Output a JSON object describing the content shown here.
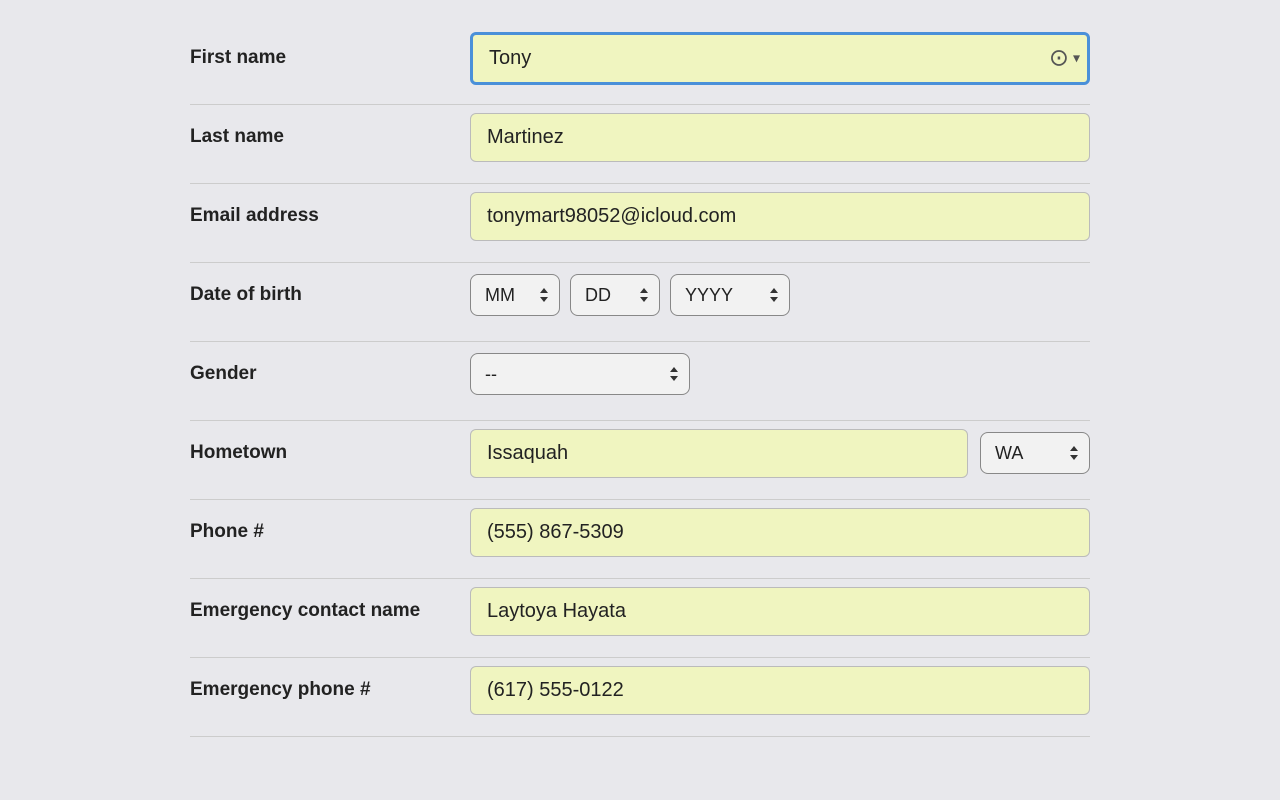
{
  "form": {
    "first_name_label": "First name",
    "first_name_value": "Tony",
    "last_name_label": "Last name",
    "last_name_value": "Martinez",
    "email_label": "Email address",
    "email_value": "tonymart98052@icloud.com",
    "dob_label": "Date of birth",
    "dob_month_placeholder": "MM",
    "dob_day_placeholder": "DD",
    "dob_year_placeholder": "YYYY",
    "gender_label": "Gender",
    "gender_value": "--",
    "hometown_label": "Hometown",
    "hometown_value": "Issaquah",
    "state_value": "WA",
    "phone_label": "Phone #",
    "phone_value": "(555) 867-5309",
    "emergency_name_label": "Emergency contact name",
    "emergency_name_value": "Laytoya Hayata",
    "emergency_phone_label": "Emergency phone #",
    "emergency_phone_value": "(617) 555-0122",
    "avatar_icon": "👤",
    "chevron_icon": "⌄"
  }
}
